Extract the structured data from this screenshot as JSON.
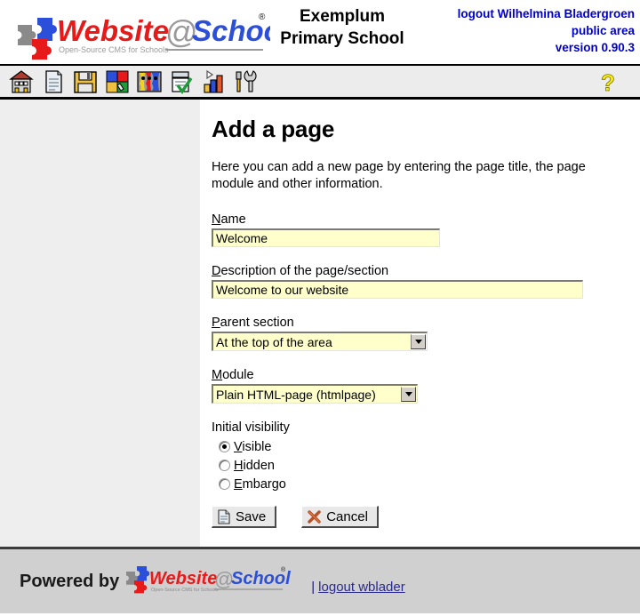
{
  "header": {
    "logo_alt": "Website@School",
    "logo_word1": "Website",
    "logo_at": "@",
    "logo_word2": "School",
    "logo_registered": "®",
    "logo_tagline": "Open-Source CMS for Schools",
    "school_name_line1": "Exemplum",
    "school_name_line2": "Primary School",
    "logout_user": "logout Wilhelmina Bladergroen",
    "area": "public area",
    "version": "version 0.90.3",
    "accent_blue": "#0000cc"
  },
  "toolbar": {
    "items": [
      {
        "name": "home-icon",
        "title": "Home"
      },
      {
        "name": "page-icon",
        "title": "Page"
      },
      {
        "name": "floppy-save-icon",
        "title": "File manager"
      },
      {
        "name": "puzzle-tools-icon",
        "title": "Page manager"
      },
      {
        "name": "colors-icon",
        "title": "Areas"
      },
      {
        "name": "checklist-icon",
        "title": "Tasks"
      },
      {
        "name": "barchart-icon",
        "title": "Statistics"
      },
      {
        "name": "tools-icon",
        "title": "Tools"
      }
    ],
    "help_icon": "question-mark-help-icon",
    "help_title": "Help"
  },
  "main": {
    "title": "Add a page",
    "intro": "Here you can add a new page by entering the page title, the page module and other information.",
    "fields": {
      "name": {
        "label_accesskey": "N",
        "label_rest": "ame",
        "value": "Welcome"
      },
      "description": {
        "label_accesskey": "D",
        "label_rest": "escription of the page/section",
        "value": "Welcome to our website"
      },
      "parent_section": {
        "label_accesskey": "P",
        "label_rest": "arent section",
        "value": "At the top of the area"
      },
      "module": {
        "label_accesskey": "M",
        "label_rest": "odule",
        "value": "Plain HTML-page (htmlpage)"
      }
    },
    "visibility": {
      "group_label": "Initial visibility",
      "options": [
        {
          "accesskey": "V",
          "rest": "isible",
          "selected": true
        },
        {
          "accesskey": "H",
          "rest": "idden",
          "selected": false
        },
        {
          "accesskey": "E",
          "rest": "mbargo",
          "selected": false
        }
      ]
    },
    "buttons": {
      "save": {
        "label": "Save",
        "icon": "document-save-icon"
      },
      "cancel": {
        "label": "Cancel",
        "icon": "cross-cancel-icon"
      }
    },
    "field_bg": "#ffffcc"
  },
  "footer": {
    "powered_by": "Powered by",
    "logo_word1": "Website",
    "logo_at": "@",
    "logo_word2": "School",
    "logo_registered": "®",
    "logo_tagline": "Open-Source CMS for Schools",
    "separator": "|",
    "logout_link": "logout wblader"
  }
}
